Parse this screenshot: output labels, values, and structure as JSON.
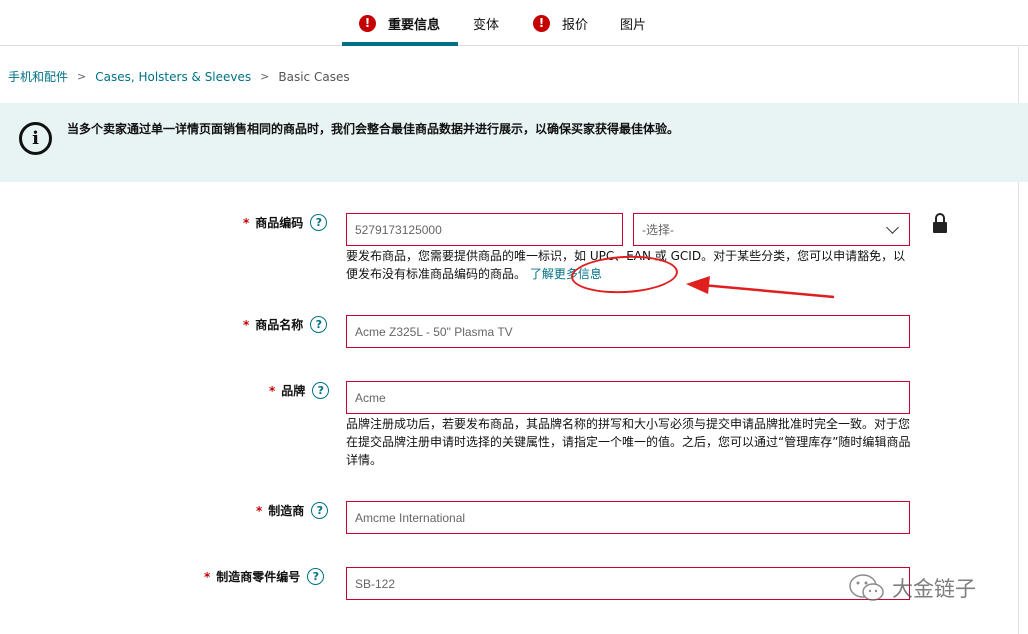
{
  "tabs": [
    {
      "label": "重要信息",
      "warning": true,
      "active": true
    },
    {
      "label": "变体",
      "warning": false,
      "active": false
    },
    {
      "label": "报价",
      "warning": true,
      "active": false
    },
    {
      "label": "图片",
      "warning": false,
      "active": false
    }
  ],
  "warning_symbol": "!",
  "breadcrumb": {
    "items": [
      "手机和配件",
      "Cases, Holsters & Sleeves",
      "Basic Cases"
    ],
    "separator": ">"
  },
  "banner": {
    "icon": "i",
    "text": "当多个卖家通过单一详情页面销售相同的商品时，我们会整合最佳商品数据并进行展示，以确保买家获得最佳体验。"
  },
  "form": {
    "required_mark": "*",
    "help_symbol": "?",
    "product_id": {
      "label": "商品编码",
      "value": "5279173125000",
      "type_select": "-选择-",
      "note": "要发布商品，您需要提供商品的唯一标识，如 UPC、EAN 或 GCID。对于某些分类，您可以申请豁免，以便发布没有标准商品编码的商品。",
      "note_link": "了解更多信息"
    },
    "product_name": {
      "label": "商品名称",
      "value": "Acme Z325L - 50\" Plasma TV"
    },
    "brand": {
      "label": "品牌",
      "value": "Acme",
      "note": "品牌注册成功后，若要发布商品，其品牌名称的拼写和大小写必须与提交申请品牌批准时完全一致。对于您在提交品牌注册申请时选择的关键属性，请指定一个唯一的值。之后，您可以通过“管理库存”随时编辑商品详情。"
    },
    "manufacturer": {
      "label": "制造商",
      "value": "Amcme International"
    },
    "part_number": {
      "label": "制造商零件编号",
      "value": "SB-122"
    }
  },
  "watermark": {
    "text": "大金链子"
  },
  "colors": {
    "accent": "#007185",
    "error": "#c7002f",
    "annotation": "#e01e1e",
    "banner_bg": "#e8f3f4"
  }
}
